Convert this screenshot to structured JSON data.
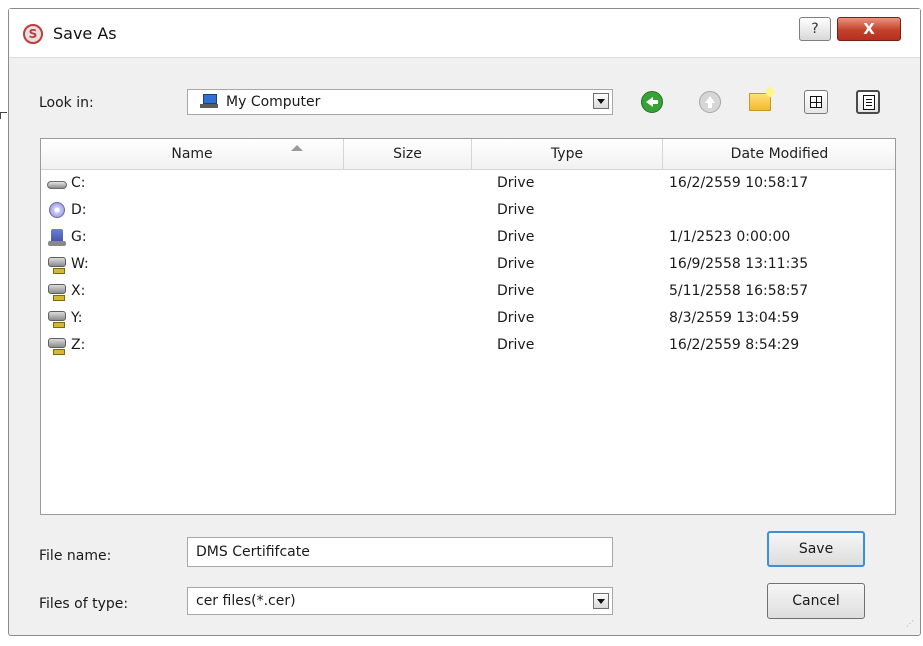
{
  "window": {
    "title": "Save As",
    "help_glyph": "?",
    "close_glyph": "X",
    "app_icon_letter": "S"
  },
  "toolbar": {
    "look_in_label": "Look in:",
    "look_in_value": "My Computer",
    "icons": [
      "back-icon",
      "up-folder-icon",
      "new-folder-icon",
      "list-view-icon",
      "detail-view-icon"
    ]
  },
  "file_list": {
    "columns": [
      "Name",
      "Size",
      "Type",
      "Date Modified"
    ],
    "rows": [
      {
        "name": "C:",
        "size": "",
        "type": "Drive",
        "modified": "16/2/2559 10:58:17",
        "icon": "hard-drive-icon"
      },
      {
        "name": "D:",
        "size": "",
        "type": "Drive",
        "modified": "",
        "icon": "cd-drive-icon"
      },
      {
        "name": "G:",
        "size": "",
        "type": "Drive",
        "modified": "1/1/2523 0:00:00",
        "icon": "usb-drive-icon"
      },
      {
        "name": "W:",
        "size": "",
        "type": "Drive",
        "modified": "16/9/2558 13:11:35",
        "icon": "network-drive-icon"
      },
      {
        "name": "X:",
        "size": "",
        "type": "Drive",
        "modified": "5/11/2558 16:58:57",
        "icon": "network-drive-icon"
      },
      {
        "name": "Y:",
        "size": "",
        "type": "Drive",
        "modified": "8/3/2559 13:04:59",
        "icon": "network-drive-icon"
      },
      {
        "name": "Z:",
        "size": "",
        "type": "Drive",
        "modified": "16/2/2559 8:54:29",
        "icon": "network-drive-icon"
      }
    ]
  },
  "form": {
    "file_name_label": "File name:",
    "file_name_value": "DMS Certififcate",
    "file_type_label": "Files of type:",
    "file_type_value": "cer files(*.cer)"
  },
  "buttons": {
    "save": "Save",
    "cancel": "Cancel"
  },
  "colors": {
    "accent": "#3d8fd6",
    "close_button": "#c4412a",
    "back_arrow": "#37a337"
  }
}
